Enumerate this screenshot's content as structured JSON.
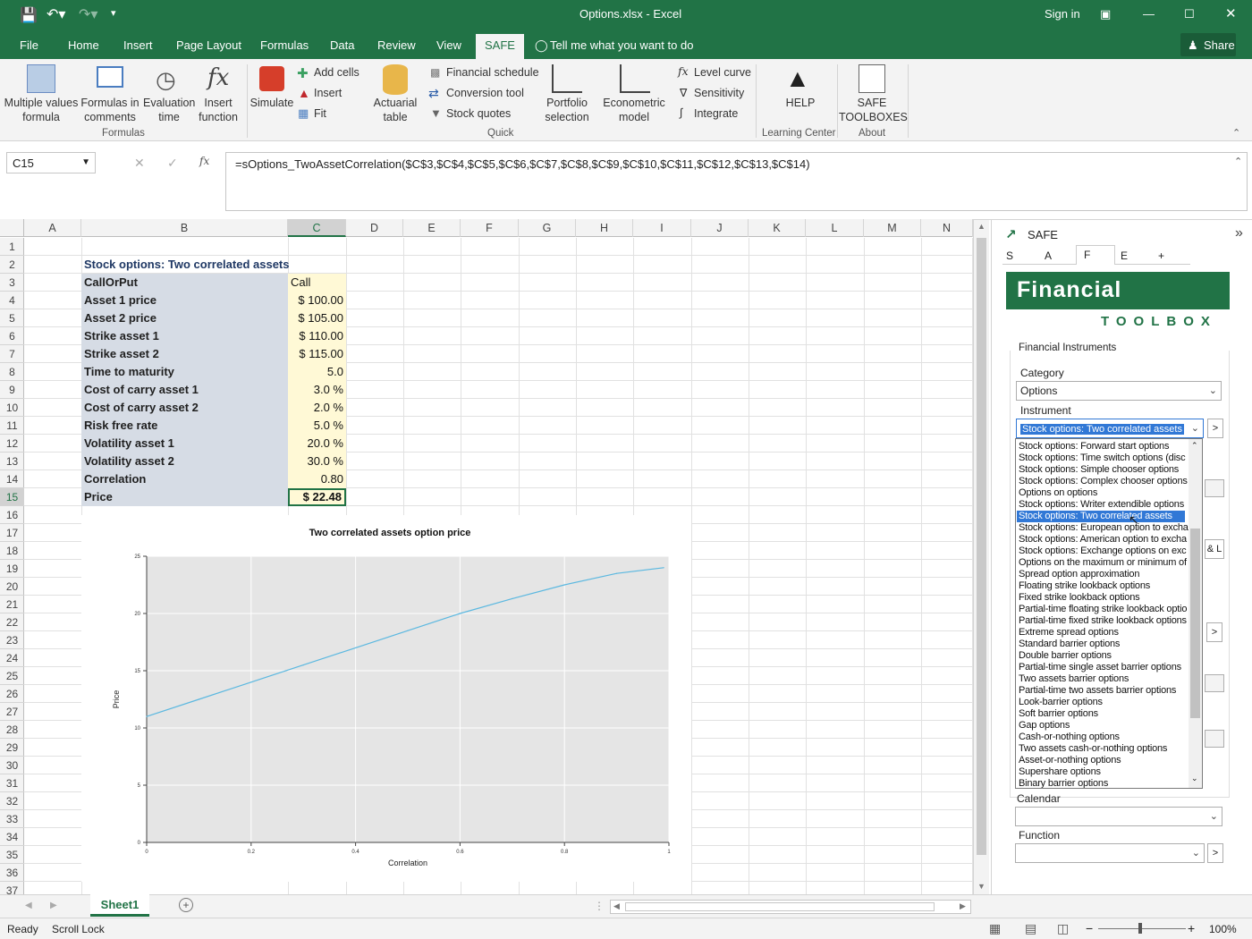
{
  "window": {
    "title": "Options.xlsx - Excel",
    "signin": "Sign in",
    "share": "Share"
  },
  "tabs": [
    "File",
    "Home",
    "Insert",
    "Page Layout",
    "Formulas",
    "Data",
    "Review",
    "View",
    "SAFE"
  ],
  "tell_me": "Tell me what you want to do",
  "ribbon": {
    "multiple_values": "Multiple values formula",
    "formulas_in_comments": "Formulas in comments",
    "evaluation_time": "Evaluation time",
    "insert_function": "Insert function",
    "formulas_group": "Formulas",
    "simulate": "Simulate",
    "add_cells": "Add cells",
    "insert": "Insert",
    "fit": "Fit",
    "actuarial_table": "Actuarial table",
    "financial_schedule": "Financial schedule",
    "conversion_tool": "Conversion tool",
    "stock_quotes": "Stock quotes",
    "portfolio_selection": "Portfolio selection",
    "econometric_model": "Econometric model",
    "quick_group": "Quick",
    "level_curve": "Level curve",
    "sensitivity": "Sensitivity",
    "integrate": "Integrate",
    "help": "HELP",
    "learning_center": "Learning Center",
    "safe_toolboxes": "SAFE TOOLBOXES",
    "about": "About"
  },
  "formula_bar": {
    "name_box": "C15",
    "formula": "=sOptions_TwoAssetCorrelation($C$3,$C$4,$C$5,$C$6,$C$7,$C$8,$C$9,$C$10,$C$11,$C$12,$C$13,$C$14)"
  },
  "columns": [
    "A",
    "B",
    "C",
    "D",
    "E",
    "F",
    "G",
    "H",
    "I",
    "J",
    "K",
    "L",
    "M",
    "N"
  ],
  "rows": [
    "1",
    "2",
    "3",
    "4",
    "5",
    "6",
    "7",
    "8",
    "9",
    "10",
    "11",
    "12",
    "13",
    "14",
    "15",
    "16",
    "17",
    "18",
    "19",
    "20",
    "21",
    "22",
    "23",
    "24",
    "25",
    "26",
    "27",
    "28",
    "29",
    "30",
    "31",
    "32",
    "33",
    "34",
    "35",
    "36",
    "37"
  ],
  "sheet": {
    "heading": "Stock options: Two correlated assets",
    "labels": [
      "CallOrPut",
      "Asset 1 price",
      "Asset 2 price",
      "Strike asset 1",
      "Strike asset 2",
      "Time to maturity",
      "Cost of carry asset 1",
      "Cost of carry asset 2",
      "Risk free rate",
      "Volatility asset 1",
      "Volatility asset 2",
      "Correlation",
      "Price"
    ],
    "values": [
      "Call",
      "$ 100.00",
      "$ 105.00",
      "$ 110.00",
      "$ 115.00",
      "5.0",
      "3.0 %",
      "2.0 %",
      "5.0 %",
      "20.0 %",
      "30.0 %",
      "0.80",
      "$ 22.48"
    ]
  },
  "chart_data": {
    "type": "line",
    "title": "Two correlated assets option price",
    "xlabel": "Correlation",
    "ylabel": "Price",
    "xlim": [
      0,
      1
    ],
    "ylim": [
      0,
      25
    ],
    "xticks": [
      "0",
      "0.2",
      "0.4",
      "0.6",
      "0.8",
      "1"
    ],
    "yticks": [
      "0",
      "5",
      "10",
      "15",
      "20",
      "25"
    ],
    "grid": true,
    "color": "#5bb8e0",
    "x": [
      0,
      0.1,
      0.2,
      0.3,
      0.4,
      0.5,
      0.6,
      0.7,
      0.8,
      0.9,
      0.99
    ],
    "y": [
      11.0,
      12.5,
      14.0,
      15.5,
      17.0,
      18.5,
      20.0,
      21.3,
      22.5,
      23.5,
      24.0
    ]
  },
  "panel": {
    "title": "SAFE",
    "tabs": [
      "S",
      "A",
      "F",
      "E",
      "+"
    ],
    "brand": "Financial",
    "brand_sub": "TOOLBOX",
    "section": "Financial Instruments",
    "category_label": "Category",
    "category_value": "Options",
    "instrument_label": "Instrument",
    "instrument_value": "Stock options: Two correlated assets",
    "calendar_label": "Calendar",
    "function_label": "Function",
    "list": [
      "Stock options: Forward start options",
      "Stock options: Time switch options (disc",
      "Stock options: Simple chooser options",
      "Stock options: Complex chooser options",
      "Options on options",
      "Stock options: Writer extendible options",
      "Stock options: Two correlated assets",
      "Stock options: European option to excha",
      "Stock options: American option to excha",
      "Stock options: Exchange options on exc",
      "Options on the maximum or minimum of t",
      "Spread option approximation",
      "Floating strike lookback options",
      "Fixed strike lookback options",
      "Partial-time floating strike lookback optio",
      "Partial-time fixed strike lookback options",
      "Extreme spread options",
      "Standard barrier options",
      "Double barrier options",
      "Partial-time single asset barrier options",
      "Two assets barrier options",
      "Partial-time two assets barrier options",
      "Look-barrier options",
      "Soft barrier options",
      "Gap options",
      "Cash-or-nothing options",
      "Two assets cash-or-nothing options",
      "Asset-or-nothing options",
      "Supershare options",
      "Binary barrier options"
    ]
  },
  "sheet_tab": "Sheet1",
  "status": {
    "ready": "Ready",
    "scroll_lock": "Scroll Lock",
    "zoom": "100%"
  }
}
